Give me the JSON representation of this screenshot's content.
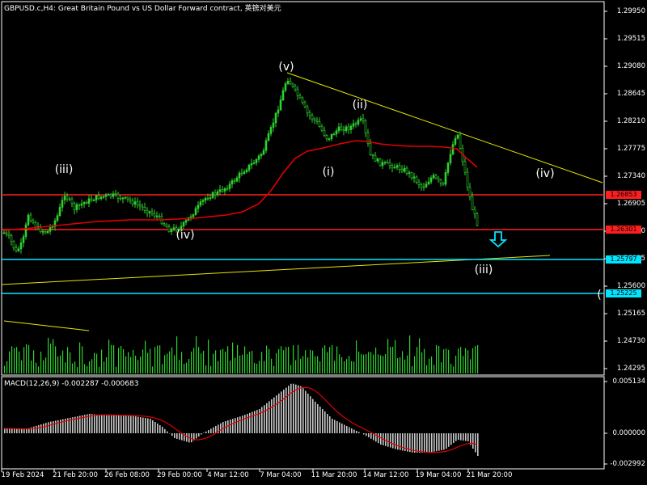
{
  "window": {
    "title": "GBPUSD.c,H4:  Great Britain Pound vs US Dollar Forward contract, 英镑对美元"
  },
  "price_axis": {
    "ticks": [
      "1.29950",
      "1.29515",
      "1.29080",
      "1.28645",
      "1.28210",
      "1.27775",
      "1.27340",
      "1.26905",
      "1.26470",
      "1.26035",
      "1.25600",
      "1.25165",
      "1.24730",
      "1.24295"
    ],
    "tags": [
      {
        "value": "1.26853",
        "color": "#ff1e1e"
      },
      {
        "value": "1.26301",
        "color": "#ff1e1e"
      },
      {
        "value": "1.25797",
        "color": "#00e5ff"
      },
      {
        "value": "1.25225",
        "color": "#00e5ff"
      }
    ]
  },
  "time_axis": {
    "ticks": [
      "19 Feb 2024",
      "21 Feb 20:00",
      "26 Feb 08:00",
      "29 Feb 00:00",
      "4 Mar 12:00",
      "7 Mar 04:00",
      "11 Mar 20:00",
      "14 Mar 12:00",
      "19 Mar 04:00",
      "21 Mar 20:00"
    ]
  },
  "waves": [
    {
      "label": "(iii)"
    },
    {
      "label": "(iv)"
    },
    {
      "label": "(v)"
    },
    {
      "label": "(i)"
    },
    {
      "label": "(ii)"
    },
    {
      "label": "(iii)"
    },
    {
      "label": "(iv)"
    },
    {
      "label": "("
    }
  ],
  "macd": {
    "label": "MACD(12,26,9) -0.002287 -0.000683",
    "ticks": [
      "0.005134",
      "0.000000",
      "-0.002992"
    ]
  },
  "colors": {
    "candle": "#2ed12e",
    "ma": "#e10000",
    "trend": "#e6e600",
    "support_line": "#ff1e1e",
    "target_line": "#00e5ff",
    "arrow": "#00e5ff"
  }
}
